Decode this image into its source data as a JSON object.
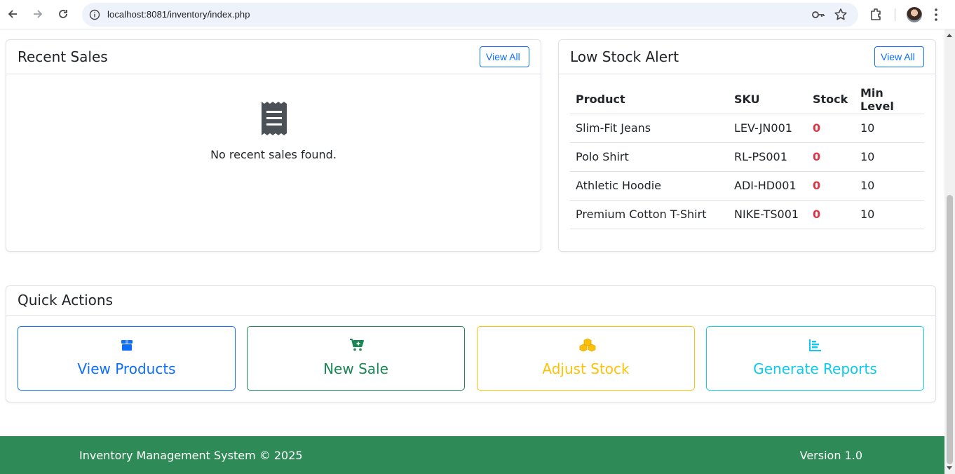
{
  "browser": {
    "url": "localhost:8081/inventory/index.php",
    "icons": [
      "back-arrow-icon",
      "forward-arrow-icon",
      "reload-icon",
      "site-info-icon",
      "key-icon",
      "star-icon",
      "extensions-icon",
      "avatar",
      "kebab-menu-icon"
    ]
  },
  "recent_sales": {
    "title": "Recent Sales",
    "view_all": "View All",
    "empty_icon": "receipt-icon",
    "empty_text": "No recent sales found."
  },
  "low_stock": {
    "title": "Low Stock Alert",
    "view_all": "View All",
    "headers": [
      "Product",
      "SKU",
      "Stock",
      "Min Level"
    ],
    "rows": [
      {
        "product": "Slim-Fit Jeans",
        "sku": "LEV-JN001",
        "stock": "0",
        "min": "10"
      },
      {
        "product": "Polo Shirt",
        "sku": "RL-PS001",
        "stock": "0",
        "min": "10"
      },
      {
        "product": "Athletic Hoodie",
        "sku": "ADI-HD001",
        "stock": "0",
        "min": "10"
      },
      {
        "product": "Premium Cotton T-Shirt",
        "sku": "NIKE-TS001",
        "stock": "0",
        "min": "10"
      }
    ],
    "zero_stock_color": "#dc3545"
  },
  "quick_actions": {
    "title": "Quick Actions",
    "buttons": [
      {
        "label": "View Products",
        "icon": "box-icon",
        "color": "#0d6efd"
      },
      {
        "label": "New Sale",
        "icon": "cart-plus-icon",
        "color": "#198754"
      },
      {
        "label": "Adjust Stock",
        "icon": "cubes-icon",
        "color": "#ffc107"
      },
      {
        "label": "Generate Reports",
        "icon": "bar-chart-icon",
        "color": "#0dcaf0"
      }
    ]
  },
  "footer": {
    "left": "Inventory Management System © 2025",
    "right": "Version 1.0",
    "background": "#2e8b57"
  }
}
